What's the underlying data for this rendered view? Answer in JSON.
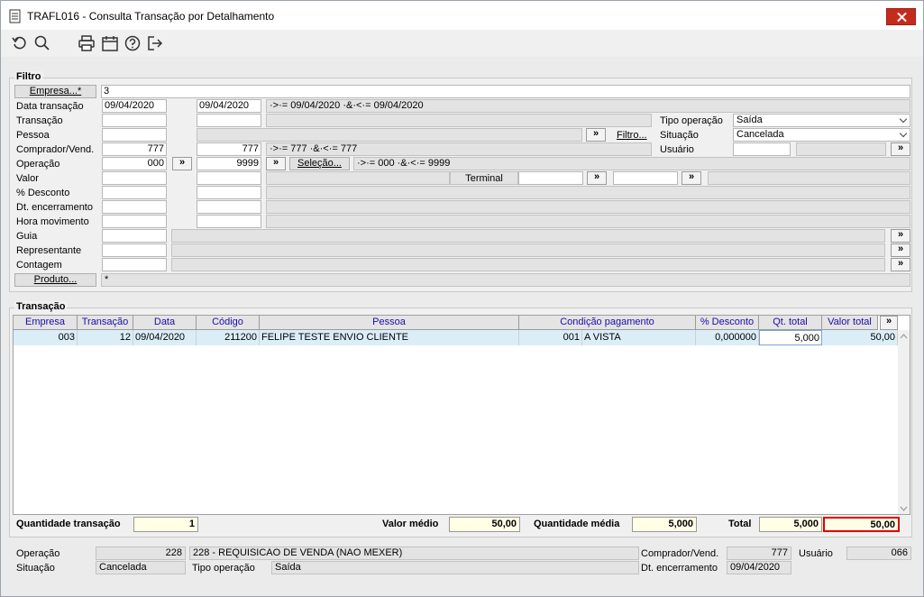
{
  "window": {
    "title": "TRAFL016 - Consulta Transação por Detalhamento"
  },
  "toolbar": {
    "icons": [
      "refresh-icon",
      "search-icon",
      "print-icon",
      "calendar-icon",
      "help-icon",
      "exit-icon"
    ]
  },
  "filtro": {
    "title": "Filtro",
    "empresa_btn": "Empresa...*",
    "empresa_value": "3",
    "data_transacao": {
      "label": "Data transação",
      "from": "09/04/2020",
      "to": "09/04/2020",
      "expr": "·>·= 09/04/2020 ·&·<·= 09/04/2020"
    },
    "transacao": {
      "label": "Transação"
    },
    "pessoa": {
      "label": "Pessoa",
      "filtro_btn": "Filtro..."
    },
    "comprador": {
      "label": "Comprador/Vend.",
      "from": "777",
      "to": "777",
      "expr": "·>·= 777 ·&·<·= 777"
    },
    "operacao": {
      "label": "Operação",
      "from": "000",
      "to": "9999",
      "selecao_btn": "Seleção...",
      "expr": "·>·= 000 ·&·<·= 9999"
    },
    "valor": {
      "label": "Valor",
      "terminal_label": "Terminal"
    },
    "desconto": {
      "label": "% Desconto"
    },
    "dt_encerramento": {
      "label": "Dt. encerramento"
    },
    "hora_movimento": {
      "label": "Hora movimento"
    },
    "guia": {
      "label": "Guia"
    },
    "representante": {
      "label": "Representante"
    },
    "contagem": {
      "label": "Contagem"
    },
    "produto_btn": "Produto...",
    "produto_value": "*",
    "tipo_operacao": {
      "label": "Tipo operação",
      "value": "Saída"
    },
    "situacao": {
      "label": "Situação",
      "value": "Cancelada"
    },
    "usuario": {
      "label": "Usuário"
    },
    "arrow": "»"
  },
  "transacao": {
    "title": "Transação",
    "columns": [
      "Empresa",
      "Transação",
      "Data",
      "Código",
      "Pessoa",
      "Condição pagamento",
      "% Desconto",
      "Qt. total",
      "Valor total"
    ],
    "rows": [
      {
        "empresa": "003",
        "transacao": "12",
        "data": "09/04/2020",
        "codigo": "211200",
        "pessoa": "FELIPE TESTE ENVIO CLIENTE",
        "cond_cod": "001",
        "cond_desc": "A VISTA",
        "desconto": "0,000000",
        "qt_total": "5,000",
        "valor_total": "50,00"
      }
    ]
  },
  "totals": {
    "quantidade_transacao_label": "Quantidade transação",
    "quantidade_transacao": "1",
    "valor_medio_label": "Valor médio",
    "valor_medio": "50,00",
    "quantidade_media_label": "Quantidade média",
    "quantidade_media": "5,000",
    "total_label": "Total",
    "total_qt": "5,000",
    "total_valor": "50,00"
  },
  "footer": {
    "operacao_label": "Operação",
    "operacao_code": "228",
    "operacao_desc": "228 - REQUISICAO DE VENDA (NAO MEXER)",
    "comprador_label": "Comprador/Vend.",
    "comprador_value": "777",
    "usuario_label": "Usuário",
    "usuario_value": "066",
    "situacao_label": "Situação",
    "situacao_value": "Cancelada",
    "tipo_operacao_label": "Tipo operação",
    "tipo_operacao_value": "Saída",
    "dt_encerramento_label": "Dt. encerramento",
    "dt_encerramento_value": "09/04/2020"
  },
  "colors": {
    "accent_red": "#e00000",
    "close_red": "#c42b1c",
    "grid_header_text": "#1a0dab",
    "row_selected": "#dbeef8",
    "total_bg": "#ffffe6"
  }
}
